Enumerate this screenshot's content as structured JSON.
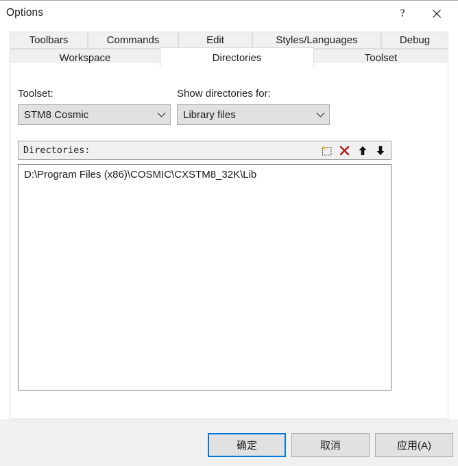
{
  "window": {
    "title": "Options",
    "help_icon": "question-mark-icon",
    "close_icon": "close-icon",
    "help_label": "?",
    "close_label": "✕"
  },
  "tabs": {
    "row1": [
      {
        "label": "Toolbars",
        "selected": false
      },
      {
        "label": "Commands",
        "selected": false
      },
      {
        "label": "Edit",
        "selected": false
      },
      {
        "label": "Styles/Languages",
        "selected": false
      },
      {
        "label": "Debug",
        "selected": false
      }
    ],
    "row2": [
      {
        "label": "Workspace",
        "selected": false
      },
      {
        "label": "Directories",
        "selected": true
      },
      {
        "label": "Toolset",
        "selected": false
      }
    ]
  },
  "page": {
    "toolset": {
      "label": "Toolset:",
      "value": "STM8 Cosmic",
      "arrow_icon": "chevron-down-icon"
    },
    "show_directories_for": {
      "label": "Show directories for:",
      "value": "Library files",
      "arrow_icon": "chevron-down-icon"
    },
    "directories": {
      "header_label": "Directories:",
      "tools": [
        {
          "name": "new-directory-icon",
          "title": "New"
        },
        {
          "name": "delete-icon",
          "title": "Delete"
        },
        {
          "name": "move-up-icon",
          "title": "Move Up"
        },
        {
          "name": "move-down-icon",
          "title": "Move Down"
        }
      ],
      "items": [
        "D:\\Program Files (x86)\\COSMIC\\CXSTM8_32K\\Lib"
      ]
    }
  },
  "footer": {
    "ok_label": "确定",
    "cancel_label": "取消",
    "apply_label": "应用(A)"
  },
  "colors": {
    "accent": "#0078d7",
    "delete_red": "#b01414",
    "new_gold": "#f2c218",
    "dialog_bg": "#f0f0f0",
    "page_bg": "#ffffff"
  }
}
